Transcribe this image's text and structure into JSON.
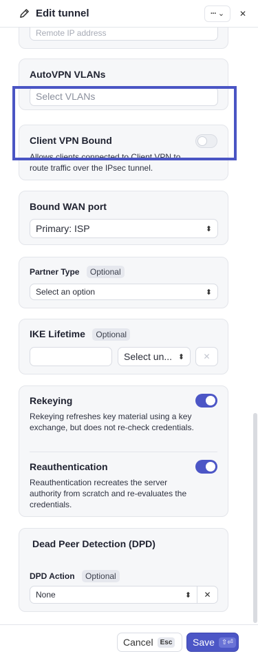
{
  "header": {
    "title": "Edit tunnel",
    "more_label": "···",
    "close_label": "✕"
  },
  "remote_ip": {
    "placeholder": "Remote IP address"
  },
  "autovpn": {
    "label": "AutoVPN VLANs",
    "placeholder": "Select VLANs"
  },
  "client_vpn": {
    "label": "Client VPN Bound",
    "description": "Allows clients connected to Client VPN to route traffic over the IPsec tunnel.",
    "enabled": false
  },
  "bound_wan": {
    "label": "Bound WAN port",
    "value": "Primary: ISP"
  },
  "partner_type": {
    "label": "Partner Type",
    "badge": "Optional",
    "value": "Select an option"
  },
  "ike_lifetime": {
    "label": "IKE Lifetime",
    "badge": "Optional",
    "value": "",
    "unit_value": "Select un...",
    "clear_label": "✕"
  },
  "rekeying": {
    "label": "Rekeying",
    "description": "Rekeying refreshes key material using a key exchange, but does not re-check credentials.",
    "enabled": true
  },
  "reauth": {
    "label": "Reauthentication",
    "description": "Reauthentication recreates the server authority from scratch and re-evaluates the credentials.",
    "enabled": true
  },
  "dpd": {
    "section_title": "Dead Peer Detection (DPD)",
    "action_label": "DPD Action",
    "badge": "Optional",
    "value": "None",
    "clear_label": "✕"
  },
  "footer": {
    "cancel_label": "Cancel",
    "cancel_kbd": "Esc",
    "save_label": "Save",
    "save_kbd": "⇧⏎"
  },
  "colors": {
    "accent": "#4c56c6",
    "highlight": "#4a55c4"
  }
}
